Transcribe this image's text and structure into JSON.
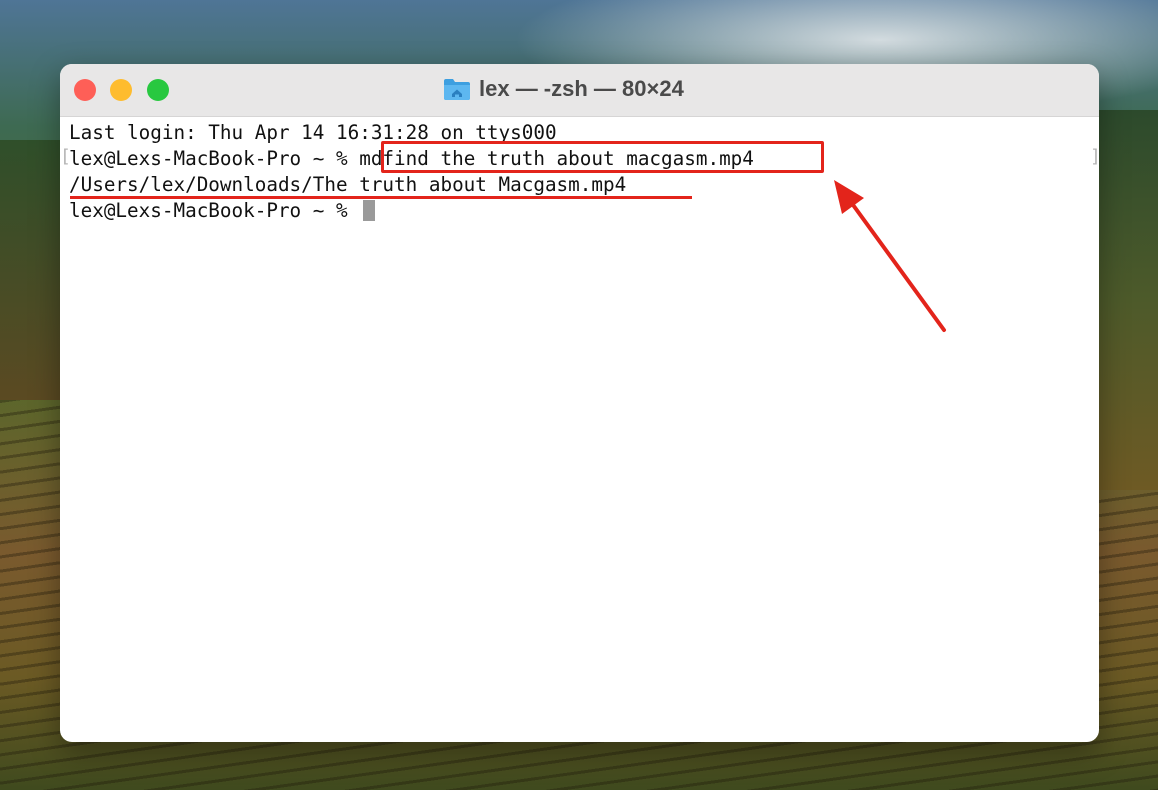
{
  "window": {
    "title": "lex — -zsh — 80×24",
    "icon": "home-folder-icon"
  },
  "terminal": {
    "lines": [
      {
        "text": "Last login: Thu Apr 14 16:31:28 on ttys000"
      },
      {
        "prompt": "lex@Lexs-MacBook-Pro ~ % ",
        "command": "mdfind the truth about macgasm.mp4"
      },
      {
        "text": "/Users/lex/Downloads/The truth about Macgasm.mp4"
      },
      {
        "prompt": "lex@Lexs-MacBook-Pro ~ % "
      }
    ],
    "bracket_left": "[",
    "bracket_right": "]"
  },
  "annotations": {
    "color": "#e3241b"
  },
  "traffic_lights": [
    "close-button",
    "minimize-button",
    "zoom-button"
  ]
}
